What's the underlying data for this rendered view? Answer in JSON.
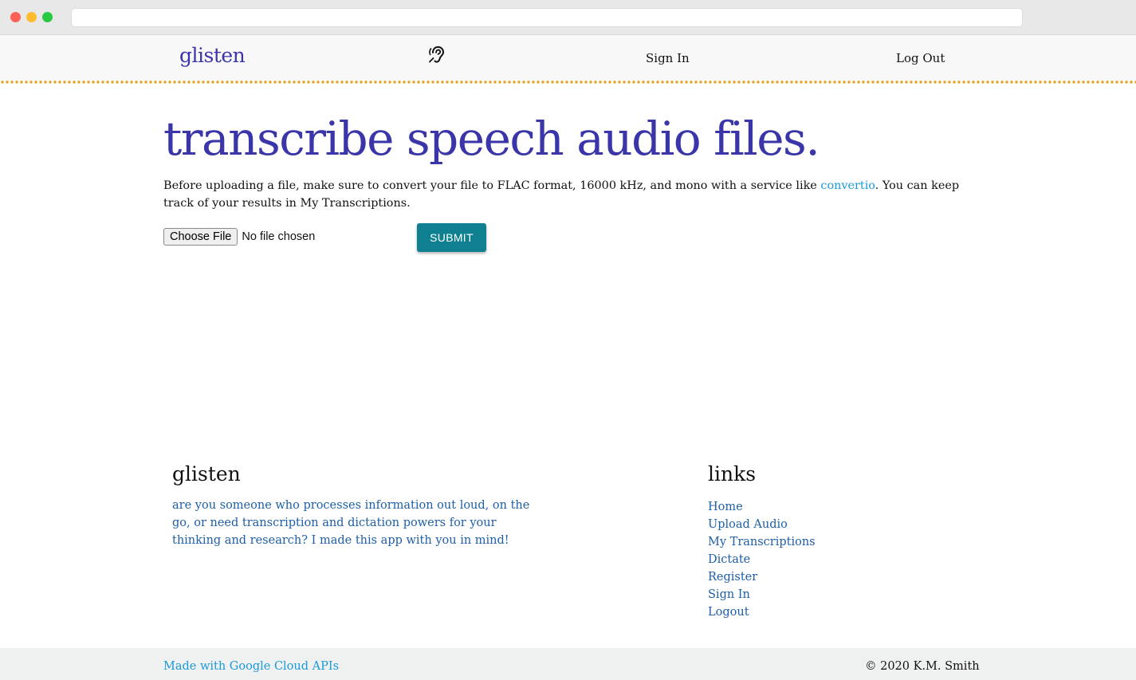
{
  "navbar": {
    "brand": "glisten",
    "ear_icon": "ear-icon",
    "sign_in": "Sign In",
    "log_out": "Log Out"
  },
  "main": {
    "headline": "transcribe speech audio files.",
    "intro_before": "Before uploading a file, make sure to convert your file to FLAC format, 16000 kHz, and mono with a service like ",
    "intro_link": "convertio",
    "intro_after": ". You can keep track of your results in My Transcriptions.",
    "choose_file": "Choose File",
    "no_file": "No file chosen",
    "submit": "SUBMIT"
  },
  "footer": {
    "title": "glisten",
    "description": "are you someone who processes information out loud, on the go, or need transcription and dictation powers for your thinking and research? I made this app with you in mind!",
    "links_title": "links",
    "links": [
      "Home",
      "Upload Audio",
      "My Transcriptions",
      "Dictate",
      "Register",
      "Sign In",
      "Logout"
    ],
    "made_with": "Made with Google Cloud APIs",
    "copyright": "© 2020 K.M. Smith"
  },
  "colors": {
    "brand": "#3a35a8",
    "accent_link": "#1a9ad6",
    "footer_link": "#1d5fa8",
    "submit_bg": "#0e8090",
    "dotted_border": "#e6a21c"
  }
}
